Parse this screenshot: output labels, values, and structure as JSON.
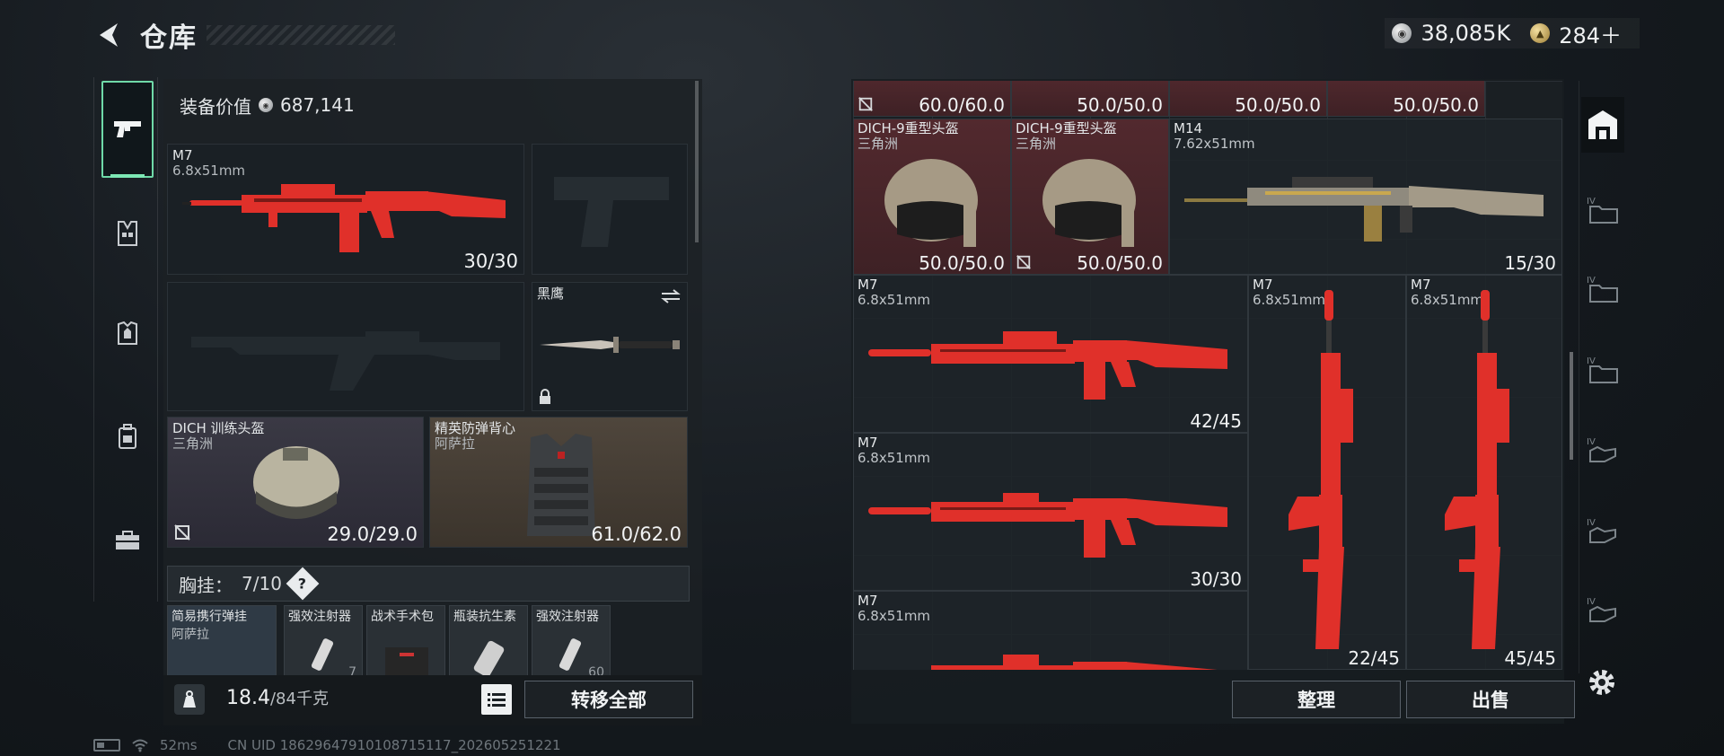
{
  "header": {
    "title": "仓库"
  },
  "currency": {
    "silver": "38,085K",
    "gold": "284＋"
  },
  "equipment": {
    "label": "装备价值",
    "value": "687,141"
  },
  "loadout": {
    "primary": {
      "name": "M7",
      "sub": "6.8x51mm",
      "dur": "30/30"
    },
    "knife": {
      "name": "黑鹰"
    },
    "helmet": {
      "name": "DICH 训练头盔",
      "sub": "三角洲",
      "dur": "29.0/29.0"
    },
    "armor": {
      "name": "精英防弹背心",
      "sub": "阿萨拉",
      "dur": "61.0/62.0"
    }
  },
  "chest_rig": {
    "label": "胸挂：",
    "count": "7/10",
    "help": "?"
  },
  "rig_items": [
    {
      "name": "简易携行弹挂",
      "sub": "阿萨拉"
    },
    {
      "name": "强效注射器",
      "sub": "7"
    },
    {
      "name": "战术手术包",
      "sub": ""
    },
    {
      "name": "瓶装抗生素",
      "sub": ""
    },
    {
      "name": "强效注射器",
      "sub": "60"
    }
  ],
  "weight": {
    "current": "18.4",
    "max": "/84",
    "unit": "千克"
  },
  "buttons": {
    "transfer_all": "转移全部",
    "sort": "整理",
    "sell": "出售"
  },
  "stash": {
    "top_row": [
      "60.0/60.0",
      "50.0/50.0",
      "50.0/50.0",
      "50.0/50.0"
    ],
    "helmet1": {
      "name": "DICH-9重型头盔",
      "sub": "三角洲",
      "dur": "50.0/50.0"
    },
    "helmet2": {
      "name": "DICH-9重型头盔",
      "sub": "三角洲",
      "dur": "50.0/50.0"
    },
    "m14": {
      "name": "M14",
      "sub": "7.62x51mm",
      "dur": "15/30"
    },
    "m7a": {
      "name": "M7",
      "sub": "6.8x51mm",
      "dur": "42/45"
    },
    "m7b": {
      "name": "M7",
      "sub": "6.8x51mm",
      "dur": "30/30"
    },
    "m7c": {
      "name": "M7",
      "sub": "6.8x51mm",
      "dur": ""
    },
    "m7v1": {
      "name": "M7",
      "sub": "6.8x51mm",
      "dur": "22/45"
    },
    "m7v2": {
      "name": "M7",
      "sub": "6.8x51mm",
      "dur": "45/45"
    }
  },
  "status": {
    "ping": "52ms",
    "uid": "CN UID 18629647910108715117_202605251221"
  },
  "colors": {
    "accent": "#6fd9a8",
    "rifle_red": "#e0302a"
  }
}
